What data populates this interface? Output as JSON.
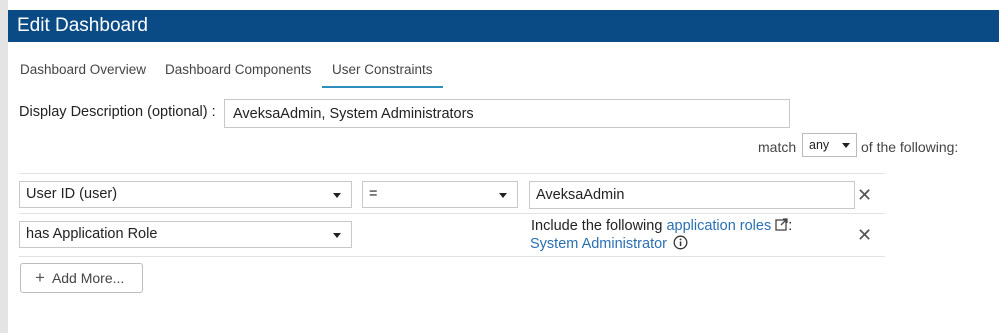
{
  "window": {
    "title": "Edit Dashboard"
  },
  "tabs": [
    {
      "label": "Dashboard Overview",
      "active": false
    },
    {
      "label": "Dashboard Components",
      "active": false
    },
    {
      "label": "User Constraints",
      "active": true
    }
  ],
  "description": {
    "label": "Display Description (optional) :",
    "value": "AveksaAdmin, System Administrators"
  },
  "match": {
    "prefix": "match",
    "selected": "any",
    "suffix": "of the following:"
  },
  "constraints": [
    {
      "attribute": "User ID (user)",
      "operator": "=",
      "value": "AveksaAdmin",
      "remove_icon": "close-icon"
    },
    {
      "attribute": "has Application Role",
      "include_text": "Include the following",
      "link_label": "application roles",
      "link_suffix": ":",
      "role": "System Administrator",
      "link_icon": "external-link-icon",
      "info_icon": "info-icon",
      "remove_icon": "close-icon"
    }
  ],
  "add_button": {
    "label": "Add More...",
    "icon": "plus-icon"
  },
  "colors": {
    "header": "#0a4b86",
    "active_tab_underline": "#2e8fbd",
    "link": "#2b6fb3"
  }
}
